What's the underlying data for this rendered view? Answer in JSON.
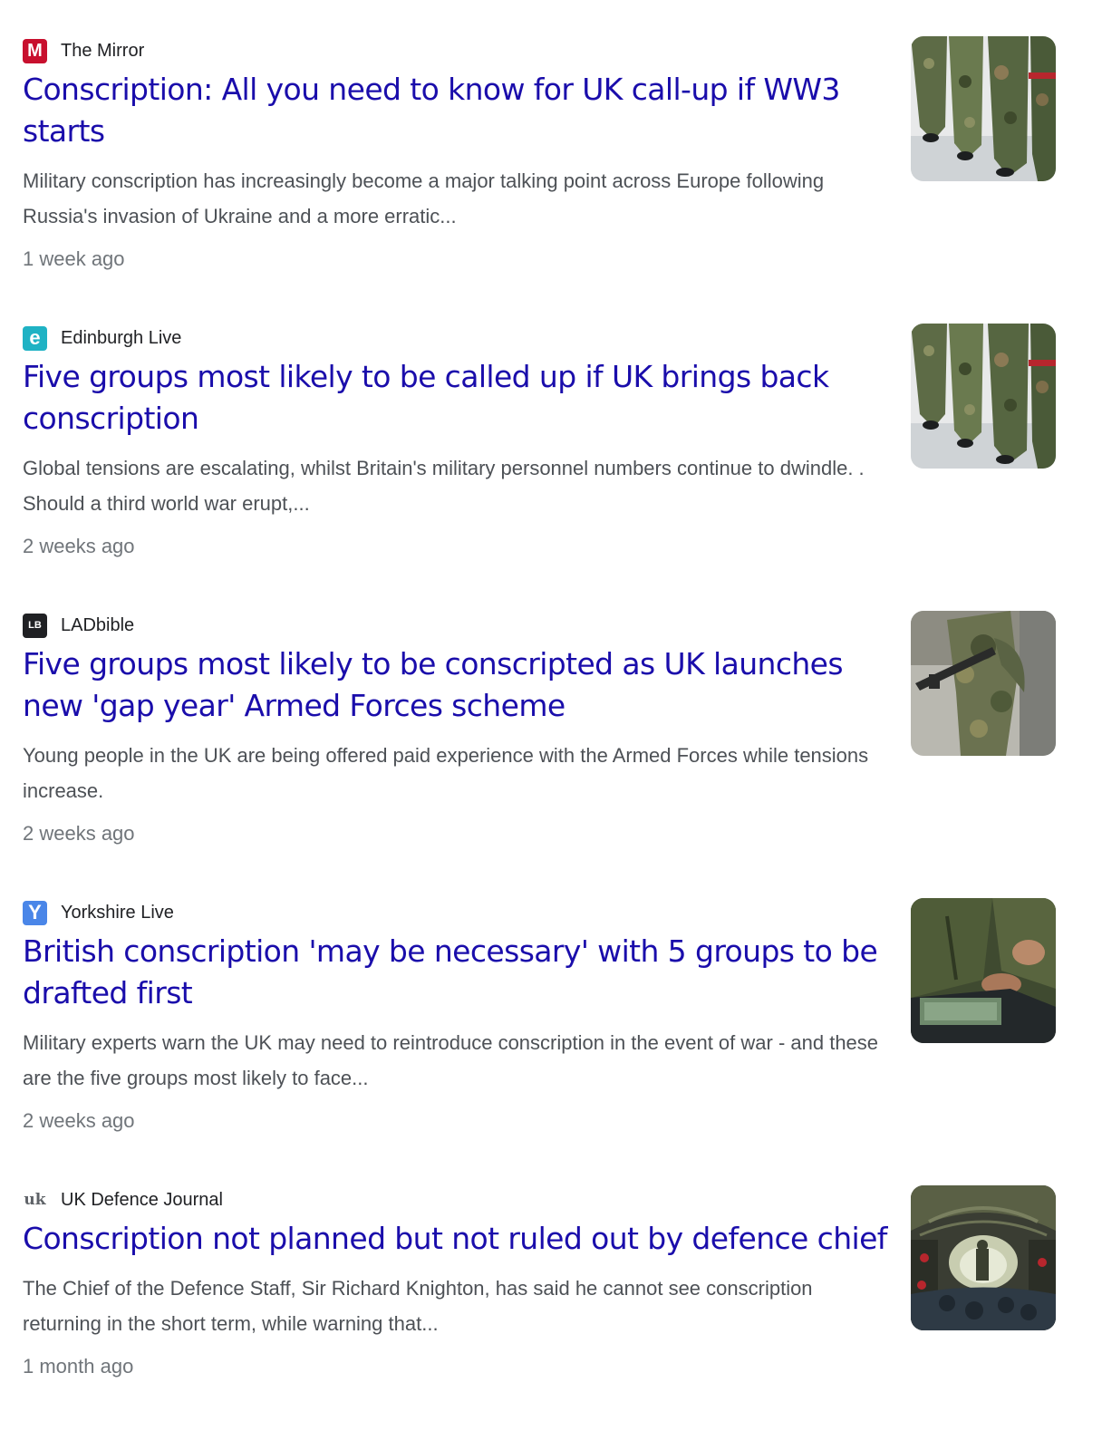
{
  "results": [
    {
      "source": "The Mirror",
      "favicon_letter": "M",
      "favicon_color": "#c8102e",
      "headline": "Conscription: All you need to know for UK call-up if WW3 starts",
      "snippet": "Military conscription has increasingly become a major talking point across Europe following Russia's invasion of Ukraine and a more erratic...",
      "time": "1 week ago",
      "thumbnail": "soldiers-marching-camouflage"
    },
    {
      "source": "Edinburgh Live",
      "favicon_letter": "e",
      "favicon_color": "#1fb2c4",
      "headline": "Five groups most likely to be called up if UK brings back conscription",
      "snippet": "Global tensions are escalating, whilst Britain's military personnel numbers continue to dwindle. . Should a third world war erupt,...",
      "time": "2 weeks ago",
      "thumbnail": "soldiers-marching-camouflage"
    },
    {
      "source": "LADbible",
      "favicon_letter": "LB",
      "favicon_color": "#202124",
      "headline": "Five groups most likely to be conscripted as UK launches new 'gap year' Armed Forces scheme",
      "snippet": "Young people in the UK are being offered paid experience with the Armed Forces while tensions increase.",
      "time": "2 weeks ago",
      "thumbnail": "soldier-with-rifle"
    },
    {
      "source": "Yorkshire Live",
      "favicon_letter": "Y",
      "favicon_color": "#4a86e8",
      "headline": "British conscription 'may be necessary' with 5 groups to be drafted first",
      "snippet": "Military experts warn the UK may need to reintroduce conscription in the event of war - and these are the five groups most likely to face...",
      "time": "2 weeks ago",
      "thumbnail": "military-uniform-hands"
    },
    {
      "source": "UK Defence Journal",
      "favicon_letter": "uk",
      "favicon_color": "#ffffff",
      "headline": "Conscription not planned but not ruled out by defence chief",
      "snippet": "The Chief of the Defence Staff, Sir Richard Knighton, has said he cannot see conscription returning in the short term, while warning that...",
      "time": "1 month ago",
      "thumbnail": "aircraft-cargo-hold-troops"
    }
  ]
}
